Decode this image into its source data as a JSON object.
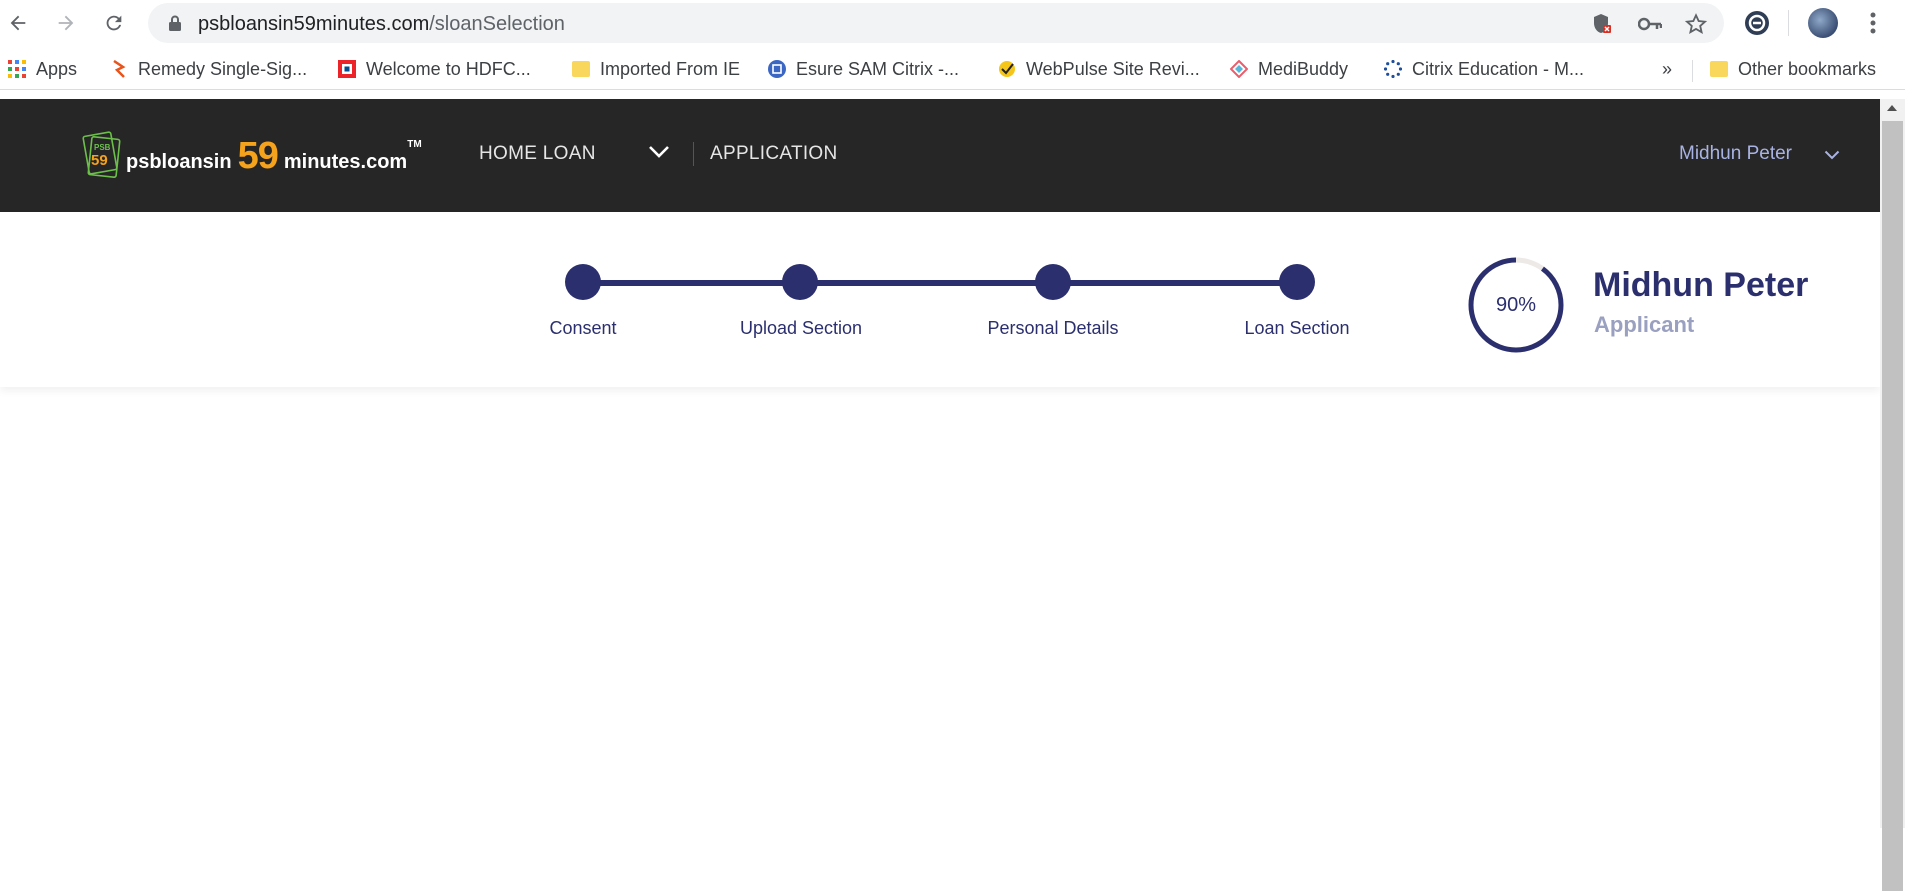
{
  "browser": {
    "url_host": "psbloansin59minutes.com",
    "url_path": "/sloanSelection",
    "bookmarks": [
      {
        "label": "Apps",
        "icon": "apps-grid-icon"
      },
      {
        "label": "Remedy Single-Sig...",
        "icon": "remedy-icon"
      },
      {
        "label": "Welcome to HDFC...",
        "icon": "hdfc-icon"
      },
      {
        "label": "Imported From IE",
        "icon": "folder-icon"
      },
      {
        "label": "Esure SAM Citrix -...",
        "icon": "esure-icon"
      },
      {
        "label": "WebPulse Site Revi...",
        "icon": "webpulse-icon"
      },
      {
        "label": "MediBuddy",
        "icon": "medibuddy-icon"
      },
      {
        "label": "Citrix Education - M...",
        "icon": "citrix-icon"
      }
    ],
    "overflow": "»",
    "other_bookmarks": "Other bookmarks"
  },
  "header": {
    "logo_prefix": "psbloansin",
    "logo_number": "59",
    "logo_suffix": "minutes.com",
    "logo_tm": "TM",
    "logo_badge_psb": "PSB",
    "logo_badge_59": "59",
    "nav_home_loan": "HOME LOAN",
    "nav_application": "APPLICATION",
    "user_name": "Midhun Peter"
  },
  "progress": {
    "steps": [
      {
        "label": "Consent"
      },
      {
        "label": "Upload Section"
      },
      {
        "label": "Personal Details"
      },
      {
        "label": "Loan Section"
      }
    ],
    "completion_percent": 90,
    "completion_label": "90%",
    "applicant_name": "Midhun Peter",
    "applicant_role": "Applicant"
  },
  "colors": {
    "brand_navy": "#2b2f6e",
    "brand_orange": "#f5a21c",
    "header_bg": "#262626",
    "user_link": "#a9b3e3"
  }
}
